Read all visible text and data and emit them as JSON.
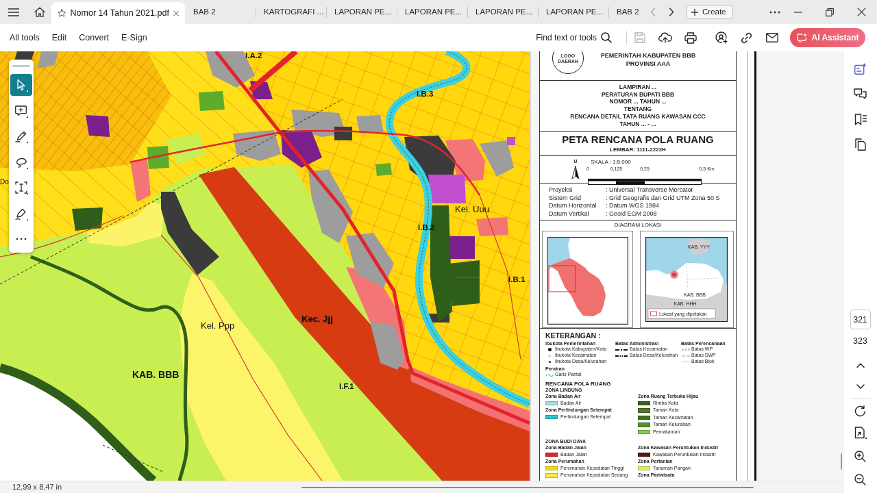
{
  "title_bar": {
    "tabs": [
      {
        "label": "Nomor 14 Tahun 2021.pdf",
        "selected": true
      },
      {
        "label": "BAB 2",
        "selected": false
      },
      {
        "label": "KARTOGRAFI ...",
        "selected": false
      },
      {
        "label": "LAPORAN PE...",
        "selected": false
      },
      {
        "label": "LAPORAN PE...",
        "selected": false
      },
      {
        "label": "LAPORAN PE...",
        "selected": false
      },
      {
        "label": "LAPORAN PE...",
        "selected": false
      },
      {
        "label": "BAB 2",
        "selected": false
      }
    ],
    "create_button": "Create"
  },
  "menu": [
    "All tools",
    "Edit",
    "Convert",
    "E-Sign"
  ],
  "find_button": "Find text or tools",
  "quick_tools": [
    {
      "kind": "save",
      "disabled": true
    },
    {
      "kind": "upload",
      "disabled": false
    },
    {
      "kind": "print",
      "disabled": false
    },
    {
      "kind": "share",
      "disabled": false
    },
    {
      "kind": "link",
      "disabled": false
    },
    {
      "kind": "mail",
      "disabled": false
    }
  ],
  "ai_button": "AI Assistant",
  "edit_tools": [
    {
      "kind": "select",
      "selected": true
    },
    {
      "kind": "comment",
      "selected": false
    },
    {
      "kind": "draw",
      "selected": false
    },
    {
      "kind": "freehand",
      "selected": false
    },
    {
      "kind": "text",
      "selected": false
    },
    {
      "kind": "sign",
      "selected": false
    },
    {
      "kind": "more",
      "selected": false
    }
  ],
  "map_labels": [
    {
      "text": "I.A.2",
      "kind": "zone-code"
    },
    {
      "text": "I.B.3",
      "kind": "zone-code"
    },
    {
      "text": "Do",
      "kind": "place"
    },
    {
      "text": "Kel. Uuu",
      "kind": "village"
    },
    {
      "text": "I.B.2",
      "kind": "zone-code"
    },
    {
      "text": "I.B.1",
      "kind": "zone-code"
    },
    {
      "text": "Kec. Jjj",
      "kind": "district"
    },
    {
      "text": "Kel. Ppp",
      "kind": "village"
    },
    {
      "text": "KAB. BBB",
      "kind": "regency"
    },
    {
      "text": "I.F.1",
      "kind": "zone-code"
    }
  ],
  "sheet": {
    "logo_lines": [
      "LOGO",
      "DAERAH"
    ],
    "authority": [
      "PEMERINTAH KABUPATEN BBB",
      "PROVINSI AAA"
    ],
    "appendix": [
      "LAMPIRAN ...",
      "PERATURAN BUPATI BBB",
      "NOMOR ... TAHUN ...",
      "TENTANG",
      "RENCANA DETAIL TATA RUANG KAWASAN CCC",
      "TAHUN ... - ..."
    ],
    "map_title": "PETA RENCANA POLA RUANG",
    "sheet_number": "LEMBAR: 1111-2222H",
    "north": "U",
    "scale": "SKALA : 1:5.000",
    "scale_ticks": [
      "0",
      "0,125",
      "0,25",
      "0,5 Km"
    ],
    "specs": [
      {
        "label": "Proyeksi",
        "value": ": Universal Transverse Mercator"
      },
      {
        "label": "Sistem Grid",
        "value": ": Grid Geografis dan Grid UTM Zona 50 S"
      },
      {
        "label": "Datum Horizontal",
        "value": ": Datum WGS 1984"
      },
      {
        "label": "Datum Vertikal",
        "value": ": Geoid EGM 2008"
      }
    ],
    "location": {
      "title": "DIAGRAM LOKASI",
      "labels": [
        "KAB. YYY",
        "KAB. BBB",
        "KAB. HHH"
      ],
      "legend": "Lokasi yang dipetakan"
    }
  },
  "legend": {
    "title": "KETERANGAN :",
    "symbol_groups": [
      {
        "title": "Ibukota Pemerintahan",
        "items": [
          {
            "kind": "capital-regency",
            "label": "Ibukota Kabupaten/Kota"
          },
          {
            "kind": "capital-district",
            "label": "Ibukota Kecamatan"
          },
          {
            "kind": "capital-village",
            "label": "Ibukota Desa/Kelurahan"
          }
        ]
      },
      {
        "title": "Batas Administrasi",
        "items": [
          {
            "kind": "district-boundary",
            "label": "Batas Kecamatan"
          },
          {
            "kind": "village-boundary",
            "label": "Batas Desa/Kelurahan"
          }
        ]
      },
      {
        "title": "Batas Perencanaan",
        "items": [
          {
            "kind": "wp-boundary",
            "label": "Batas WP"
          },
          {
            "kind": "swp-boundary",
            "label": "Batas SWP"
          },
          {
            "kind": "block-boundary",
            "label": "Batas Blok"
          }
        ]
      }
    ],
    "waters": {
      "title": "Perairan",
      "items": [
        {
          "kind": "coastline",
          "label": "Garis Pantai"
        }
      ]
    },
    "plan_title": "RENCANA POLA RUANG",
    "zones": [
      {
        "title": "ZONA LINDUNG",
        "left": [
          {
            "title": "Zona Badan Air",
            "items": [
              {
                "label": "Badan Air",
                "color": "#a8d8ec"
              }
            ]
          },
          {
            "title": "Zona Perlindungan Setempat",
            "items": [
              {
                "label": "Perlindungan Setempat",
                "color": "#33c3d3"
              }
            ]
          }
        ],
        "right": [
          {
            "title": "Zona Ruang Terbuka Hijau",
            "items": [
              {
                "label": "Rimba Kota",
                "color": "#3d5f22"
              },
              {
                "label": "Taman Kota",
                "color": "#4b7a24"
              },
              {
                "label": "Taman Kecamatan",
                "color": "#42701f"
              },
              {
                "label": "Taman Kelurahan",
                "color": "#55902a"
              },
              {
                "label": "Pemakaman",
                "color": "#7cd444"
              }
            ]
          }
        ]
      },
      {
        "title": "ZONA BUDI DAYA",
        "left": [
          {
            "title": "Zona Badan Jalan",
            "items": [
              {
                "label": "Badan Jalan",
                "color": "#d9262e"
              }
            ]
          },
          {
            "title": "Zona Perumahan",
            "items": [
              {
                "label": "Perumahan Kepadatan Tinggi",
                "color": "#f4dc00"
              },
              {
                "label": "Perumahan Kepadatan Sedang",
                "color": "#f8ee30"
              }
            ]
          }
        ],
        "right": [
          {
            "title": "Zona Kawasan Peruntukan Industri",
            "items": [
              {
                "label": "Kawasan Peruntukan Industri",
                "color": "#5c1515"
              }
            ]
          },
          {
            "title": "Zona Pertanian",
            "items": [
              {
                "label": "Tanaman Pangan",
                "color": "#d7f55c"
              }
            ]
          },
          {
            "title": "Zona Pariwisata"
          }
        ]
      }
    ]
  },
  "page_nav": {
    "current": "321",
    "total": "323"
  },
  "status_bar": {
    "page_size": "12,99 x 8,47 in"
  }
}
